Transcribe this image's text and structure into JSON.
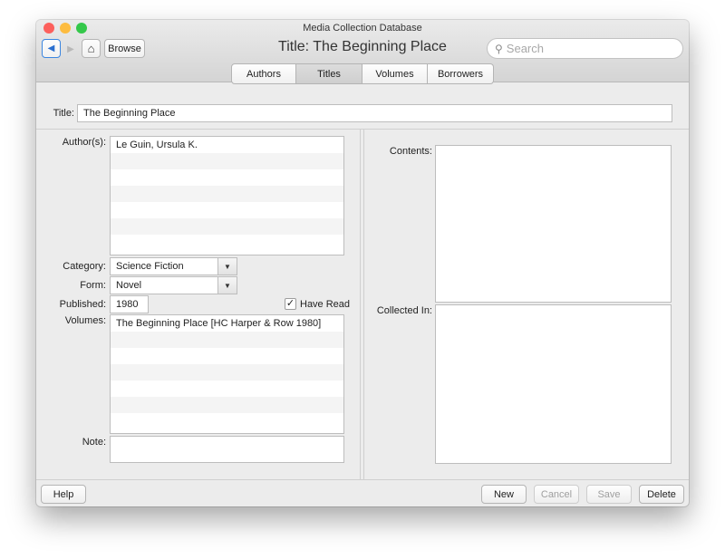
{
  "window": {
    "title": "Media Collection Database"
  },
  "toolbar": {
    "back_glyph": "◀",
    "forward_glyph": "▶",
    "home_glyph": "⌂",
    "browse_label": "Browse",
    "document_title": "Title: The Beginning Place",
    "search_placeholder": "Search",
    "search_glyph": "⚲"
  },
  "tabs": [
    {
      "label": "Authors",
      "selected": false
    },
    {
      "label": "Titles",
      "selected": true
    },
    {
      "label": "Volumes",
      "selected": false
    },
    {
      "label": "Borrowers",
      "selected": false
    }
  ],
  "form": {
    "title_label": "Title:",
    "title_value": "The Beginning Place",
    "authors_label": "Author(s):",
    "authors": [
      "Le Guin, Ursula K.",
      "",
      "",
      "",
      "",
      "",
      ""
    ],
    "category_label": "Category:",
    "category_value": "Science Fiction",
    "form_label": "Form:",
    "form_value": "Novel",
    "published_label": "Published:",
    "published_value": "1980",
    "have_read_label": "Have Read",
    "have_read_checked": "✓",
    "volumes_label": "Volumes:",
    "volumes": [
      "The Beginning Place [HC Harper & Row 1980]",
      "",
      "",
      "",
      "",
      "",
      ""
    ],
    "note_label": "Note:",
    "note_value": "",
    "contents_label": "Contents:",
    "collected_in_label": "Collected In:",
    "combo_arrow": "▼"
  },
  "footer": {
    "help_label": "Help",
    "new_label": "New",
    "cancel_label": "Cancel",
    "save_label": "Save",
    "delete_label": "Delete"
  },
  "colors": {
    "close": "#fc605c",
    "minimize": "#fdbc40",
    "zoom": "#34c84a",
    "accent": "#3b86e0"
  }
}
